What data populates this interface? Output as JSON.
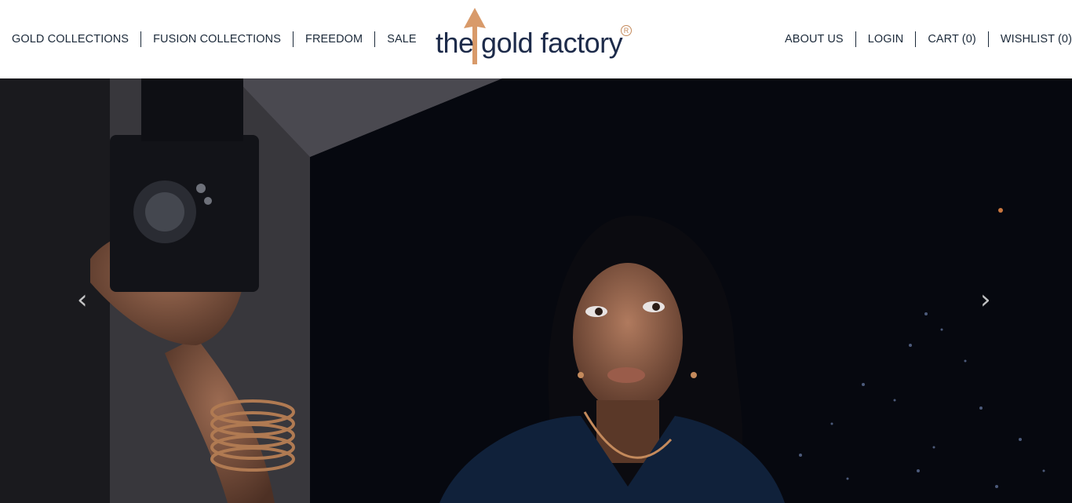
{
  "brand": {
    "logo_text": "the gold factory",
    "registered_mark": "R",
    "accent_color": "#c48a5c",
    "text_color": "#1d2b4a"
  },
  "nav_left": [
    {
      "label": "GOLD COLLECTIONS"
    },
    {
      "label": "FUSION COLLECTIONS"
    },
    {
      "label": "FREEDOM"
    },
    {
      "label": "SALE"
    }
  ],
  "nav_right": [
    {
      "label": "ABOUT US"
    },
    {
      "label": "LOGIN"
    },
    {
      "label": "CART (0)"
    },
    {
      "label": "WISHLIST (0)"
    }
  ],
  "hero": {
    "prev_icon": "chevron-left-icon",
    "next_icon": "chevron-right-icon",
    "prev_glyph": "‹",
    "next_glyph": "›",
    "background_color": "#070a12"
  }
}
